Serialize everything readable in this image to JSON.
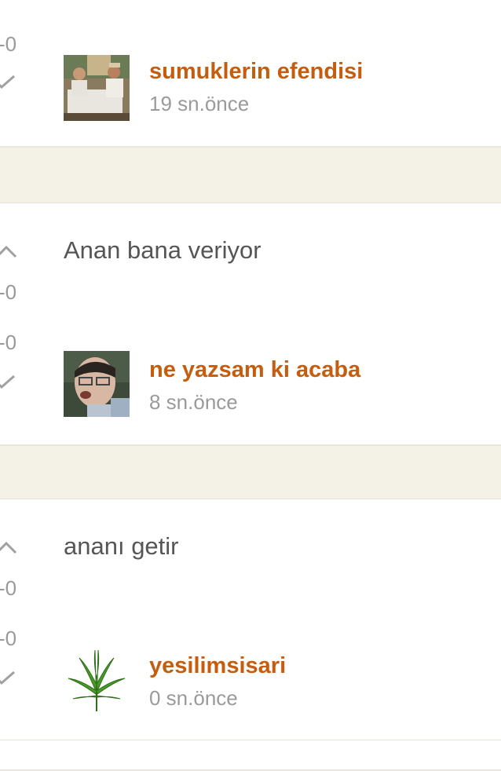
{
  "comments": [
    {
      "text": "",
      "score_top": "-0",
      "score_bottom": "-0",
      "username": "sumuklerin efendisi",
      "time": "19 sn.önce",
      "avatar": "photo-two-men-at-table"
    },
    {
      "text": "Anan bana veriyor",
      "score_top": "-0",
      "score_bottom": "-0",
      "username": "ne yazsam ki acaba",
      "time": "8 sn.önce",
      "avatar": "photo-young-man-glasses"
    },
    {
      "text": "ananı getir",
      "score_top": "-0",
      "score_bottom": "-0",
      "username": "yesilimsisari",
      "time": "0 sn.önce",
      "avatar": "cannabis-leaf"
    }
  ],
  "colors": {
    "username": "#c65d0e",
    "muted": "#9a9a9a",
    "text": "#555555",
    "background": "#f4f1e6",
    "card": "#ffffff"
  },
  "icons": {
    "upvote": "chevron-up-icon",
    "downvote": "check-icon"
  }
}
